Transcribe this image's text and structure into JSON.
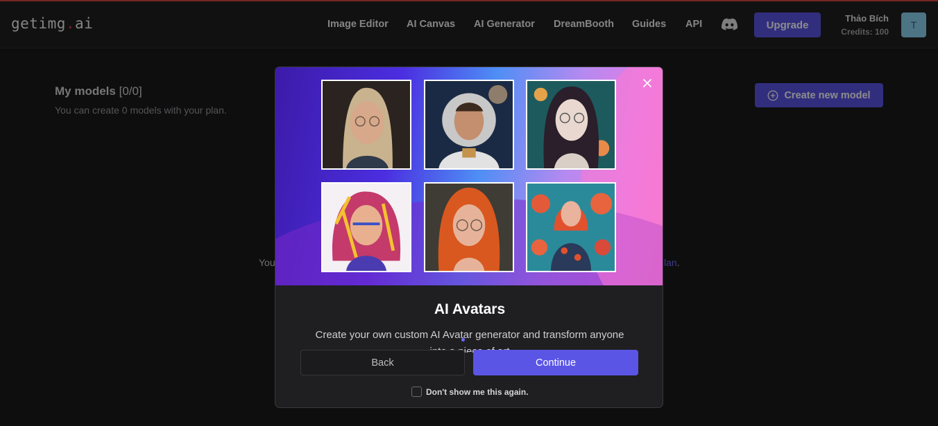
{
  "header": {
    "logo_text": "getimg",
    "logo_dot": ".",
    "logo_suffix": "ai",
    "nav": [
      "Image Editor",
      "AI Canvas",
      "AI Generator",
      "DreamBooth",
      "Guides",
      "API"
    ],
    "upgrade_label": "Upgrade",
    "user_name": "Thảo Bích",
    "credits": "Credits: 100",
    "avatar_initial": "T"
  },
  "page": {
    "title": "My models",
    "count": "[0/0]",
    "subtitle": "You can create 0 models with your plan.",
    "create_label": "Create new model",
    "bg_text_left": "You",
    "bg_text_right_link": "lan",
    "bg_text_right_end": "."
  },
  "modal": {
    "title": "AI Avatars",
    "description": "Create your own custom AI Avatar generator and transform anyone",
    "description_2": "into a piece of art",
    "back_label": "Back",
    "continue_label": "Continue",
    "checkbox_label": "Don't show me this again.",
    "close_icon": "close-icon"
  },
  "colors": {
    "accent": "#5b55e6",
    "background": "#1a1a1b",
    "logo_dot": "#e33a4b"
  }
}
